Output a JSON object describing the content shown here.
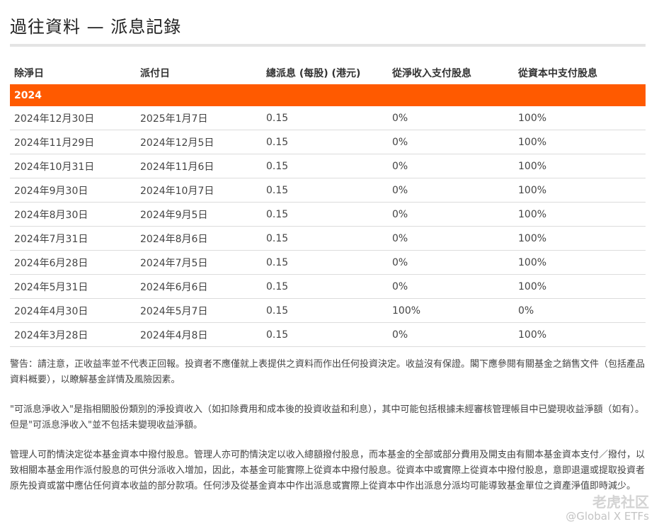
{
  "page": {
    "title": "過往資料 — 派息記錄"
  },
  "table": {
    "headers": [
      "除淨日",
      "派付日",
      "總派息 (每股) (港元)",
      "從淨收入支付股息",
      "從資本中支付股息"
    ],
    "year_label": "2024",
    "rows": [
      [
        "2024年12月30日",
        "2025年1月7日",
        "0.15",
        "0%",
        "100%"
      ],
      [
        "2024年11月29日",
        "2024年12月5日",
        "0.15",
        "0%",
        "100%"
      ],
      [
        "2024年10月31日",
        "2024年11月6日",
        "0.15",
        "0%",
        "100%"
      ],
      [
        "2024年9月30日",
        "2024年10月7日",
        "0.15",
        "0%",
        "100%"
      ],
      [
        "2024年8月30日",
        "2024年9月5日",
        "0.15",
        "0%",
        "100%"
      ],
      [
        "2024年7月31日",
        "2024年8月6日",
        "0.15",
        "0%",
        "100%"
      ],
      [
        "2024年6月28日",
        "2024年7月5日",
        "0.15",
        "0%",
        "100%"
      ],
      [
        "2024年5月31日",
        "2024年6月6日",
        "0.15",
        "0%",
        "100%"
      ],
      [
        "2024年4月30日",
        "2024年5月7日",
        "0.15",
        "100%",
        "0%"
      ],
      [
        "2024年3月28日",
        "2024年4月8日",
        "0.15",
        "0%",
        "100%"
      ]
    ]
  },
  "notes": {
    "warning": "警告：請注意，正收益率並不代表正回報。投資者不應僅就上表提供之資料而作出任何投資決定。收益沒有保證。閣下應參閱有關基金之銷售文件（包括產品資料概要），以瞭解基金詳情及風險因素。",
    "distributable": "\"可派息淨收入\"是指相關股份類別的淨投資收入（如扣除費用和成本後的投資收益和利息），其中可能包括根據未經審核管理帳目中已變現收益淨額（如有）。但是\"可派息淨收入\"並不包括未變現收益淨額。",
    "capital": "管理人可酌情決定從本基金資本中撥付股息。管理人亦可酌情決定以收入總額撥付股息，而本基金的全部或部分費用及開支由有關本基金資本支付／撥付，以致相關本基金用作派付股息的可供分派收入增加，因此，本基金可能實際上從資本中撥付股息。從資本中或實際上從資本中撥付股息，意即退還或提取投資者原先投資或當中應佔任何資本收益的部分款項。任何涉及從基金資本中作出派息或實際上從資本中作出派息分派均可能導致基金單位之資產淨值即時減少。"
  },
  "watermark": {
    "logo_text": "老虎社区",
    "account": "@Global X ETFs"
  },
  "colors": {
    "accent": "#ff5a00"
  }
}
